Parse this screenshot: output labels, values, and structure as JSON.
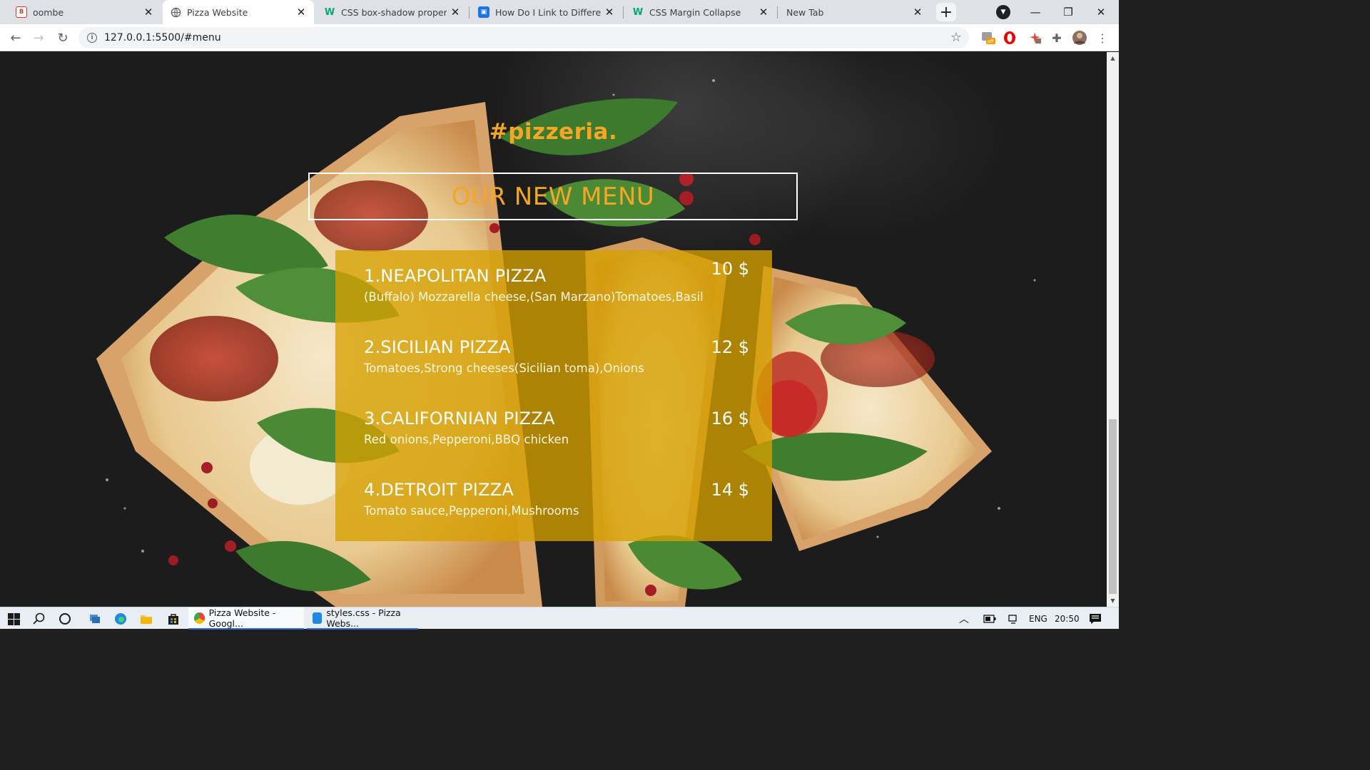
{
  "browser": {
    "tabs": [
      {
        "title": "oombe",
        "icon": "calendar-icon",
        "active": false
      },
      {
        "title": "Pizza Website",
        "icon": "globe-icon",
        "active": true
      },
      {
        "title": "CSS box-shadow property",
        "icon": "w3schools-icon",
        "active": false
      },
      {
        "title": "How Do I Link to Different S",
        "icon": "doc-icon",
        "active": false
      },
      {
        "title": "CSS Margin Collapse",
        "icon": "w3schools-icon",
        "active": false
      },
      {
        "title": "New Tab",
        "icon": "",
        "active": false
      }
    ],
    "url": "127.0.0.1:5500/#menu",
    "extension_badge": "off"
  },
  "page": {
    "brand": "#pizzeria.",
    "heading": "OUR NEW MENU",
    "menu": [
      {
        "name": "1.NEAPOLITAN PIZZA",
        "desc": "(Buffalo) Mozzarella cheese,(San Marzano)Tomatoes,Basil",
        "price": "10 $"
      },
      {
        "name": "2.SICILIAN PIZZA",
        "desc": "Tomatoes,Strong cheeses(Sicilian toma),Onions",
        "price": "12 $"
      },
      {
        "name": "3.CALIFORNIAN PIZZA",
        "desc": "Red onions,Pepperoni,BBQ chicken",
        "price": "16 $"
      },
      {
        "name": "4.DETROIT PIZZA",
        "desc": "Tomato sauce,Pepperoni,Mushrooms",
        "price": "14 $"
      }
    ],
    "colors": {
      "accent": "#f5a623",
      "card": "#d6a000"
    }
  },
  "taskbar": {
    "apps": [
      {
        "label": "Pizza Website - Googl...",
        "icon": "chrome-icon"
      },
      {
        "label": "styles.css - Pizza Webs...",
        "icon": "vscode-icon"
      }
    ],
    "language": "ENG",
    "time": "20:50"
  }
}
